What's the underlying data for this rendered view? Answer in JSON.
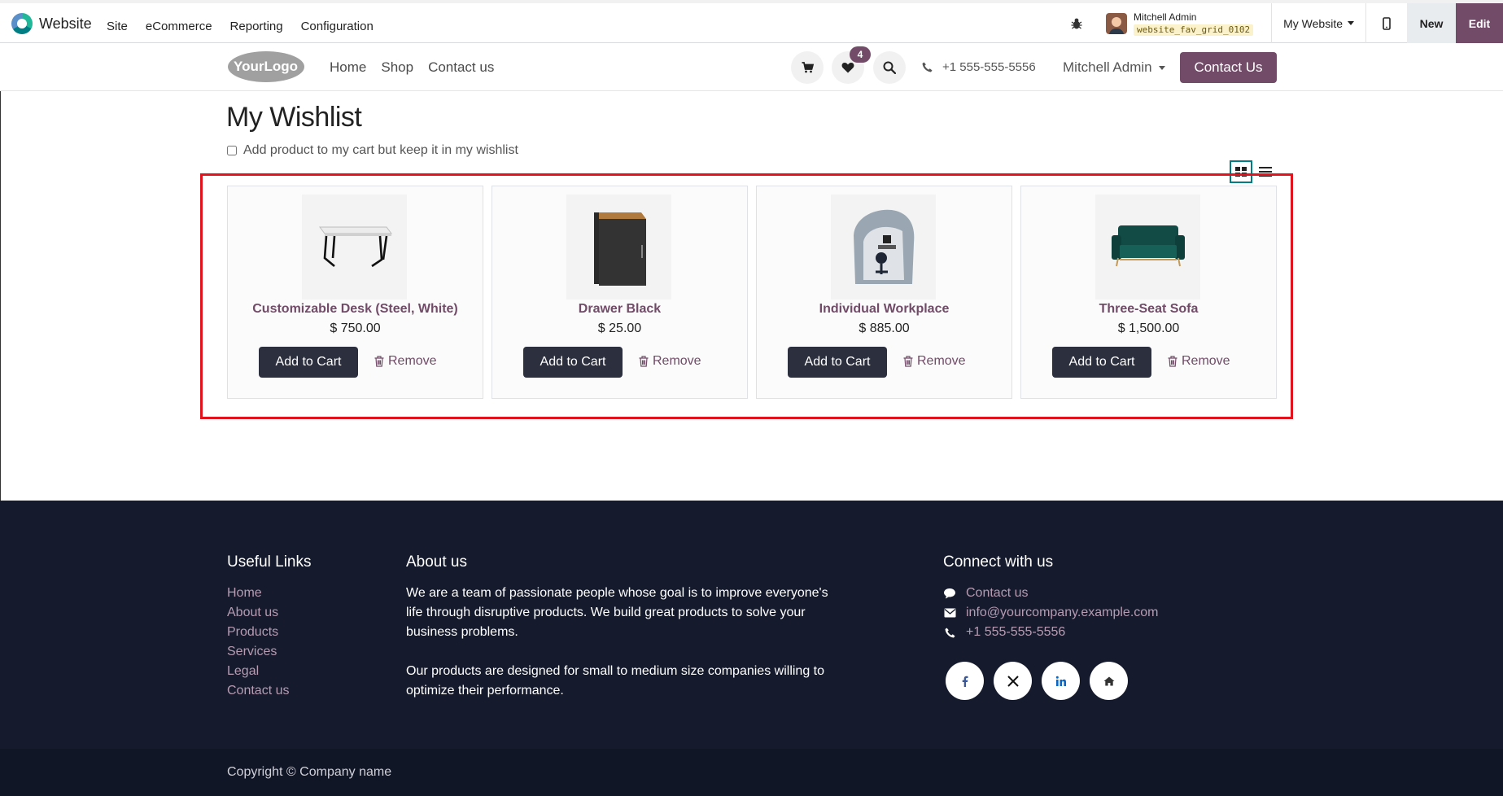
{
  "admin_bar": {
    "app_title": "Website",
    "menu": [
      "Site",
      "eCommerce",
      "Reporting",
      "Configuration"
    ],
    "user_name": "Mitchell Admin",
    "database": "website_fav_grid_0102",
    "website_selector": "My Website",
    "new_label": "New",
    "edit_label": "Edit"
  },
  "header": {
    "logo_text": "YourLogo",
    "nav": [
      "Home",
      "Shop",
      "Contact us"
    ],
    "wishlist_count": "4",
    "phone": "+1 555-555-5556",
    "user_menu": "Mitchell Admin",
    "contact_button": "Contact Us"
  },
  "wishlist": {
    "title": "My Wishlist",
    "keep_in_wishlist_label": "Add product to my cart but keep it in my wishlist",
    "keep_in_wishlist_checked": false,
    "view_mode": "grid",
    "add_to_cart_label": "Add to Cart",
    "remove_label": "Remove",
    "items": [
      {
        "name": "Customizable Desk (Steel, White)",
        "price": "$ 750.00",
        "image": "desk"
      },
      {
        "name": "Drawer Black",
        "price": "$ 25.00",
        "image": "drawer"
      },
      {
        "name": "Individual Workplace",
        "price": "$ 885.00",
        "image": "workplace"
      },
      {
        "name": "Three-Seat Sofa",
        "price": "$ 1,500.00",
        "image": "sofa"
      }
    ]
  },
  "footer": {
    "useful_links_title": "Useful Links",
    "useful_links": [
      "Home",
      "About us",
      "Products",
      "Services",
      "Legal",
      "Contact us"
    ],
    "about_title": "About us",
    "about_p1": "We are a team of passionate people whose goal is to improve everyone's life through disruptive products. We build great products to solve your business problems.",
    "about_p2": "Our products are designed for small to medium size companies willing to optimize their performance.",
    "connect_title": "Connect with us",
    "connect_contact": "Contact us",
    "connect_email": "info@yourcompany.example.com",
    "connect_phone": "+1 555-555-5556",
    "socials": [
      "facebook-icon",
      "x-icon",
      "linkedin-icon",
      "home-icon"
    ],
    "copyright": "Copyright © Company name"
  },
  "colors": {
    "brand": "#714b67",
    "footer_bg": "#151b2d",
    "highlight": "#e1141e"
  }
}
